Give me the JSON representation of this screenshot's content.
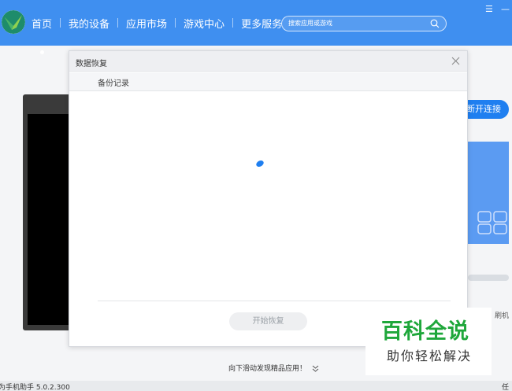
{
  "nav": {
    "items": [
      {
        "label": "首页",
        "active": true
      },
      {
        "label": "我的设备"
      },
      {
        "label": "应用市场"
      },
      {
        "label": "游戏中心"
      },
      {
        "label": "更多服务"
      }
    ]
  },
  "search": {
    "placeholder": "搜索应用或游戏"
  },
  "window": {
    "menu": "☰",
    "minimize": "—"
  },
  "background": {
    "disconnect": "断开连接",
    "side_label": "刷机",
    "scroll_hint": "向下滑动发现精品应用！",
    "version": "为手机助手 5.0.2.300",
    "task": "任"
  },
  "dialog": {
    "title": "数据恢复",
    "tab": "备份记录",
    "start_button": "开始恢复"
  },
  "watermark": {
    "line1": "百科全说",
    "line2": "助你轻松解决"
  },
  "colors": {
    "brand": "#3f8ff0",
    "button": "#1f7ff0",
    "spinner": "#1f7ff0",
    "watermark": "#1fa73b"
  }
}
